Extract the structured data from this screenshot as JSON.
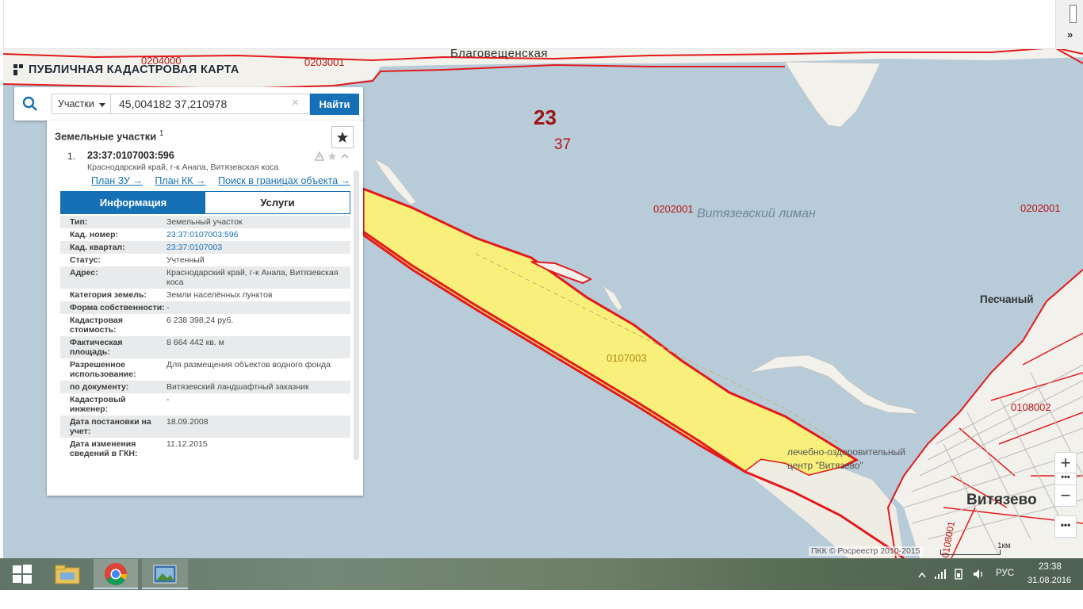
{
  "app": {
    "title": "ПУБЛИЧНАЯ КАДАСТРОВАЯ КАРТА"
  },
  "search": {
    "type_label": "Участки",
    "query": "45,004182 37,210978",
    "clear_icon": "×",
    "button_label": "Найти"
  },
  "browser": {
    "more_label": "»"
  },
  "panel": {
    "title": "Земельные участки",
    "count": "1",
    "item": {
      "index": "1.",
      "cad_number": "23:37:0107003:596",
      "address": "Краснодарский край, г-к Анапа, Витязевская коса"
    },
    "links": [
      "План ЗУ →",
      "План КК →",
      "Поиск в границах объекта →"
    ],
    "tabs": [
      "Информация",
      "Услуги"
    ],
    "rows": [
      {
        "key": "Тип:",
        "value": "Земельный участок"
      },
      {
        "key": "Кад. номер:",
        "value": "23:37:0107003:596"
      },
      {
        "key": "Кад. квартал:",
        "value": "23:37:0107003"
      },
      {
        "key": "Статус:",
        "value": "Учтенный"
      },
      {
        "key": "Адрес:",
        "value": "Краснодарский край, г-к Анапа, Витязевская коса"
      },
      {
        "key": "Категория земель:",
        "value": "Земли населённых пунктов"
      },
      {
        "key": "Форма собственности:",
        "value": "-"
      },
      {
        "key": "Кадастровая стоимость:",
        "value": "6 238 398,24 руб."
      },
      {
        "key": "Фактическая площадь:",
        "value": "8 664 442 кв. м"
      },
      {
        "key": "Разрешенное использование:",
        "value": "Для размещения объектов водного фонда"
      },
      {
        "key": "по документу:",
        "value": "Витязевский ландшафтный заказник"
      },
      {
        "key": "Кадастровый инженер:",
        "value": "-"
      },
      {
        "key": "Дата постановки на учет:",
        "value": "18.09.2008"
      },
      {
        "key": "Дата изменения сведений в ГКН:",
        "value": "11.12.2015"
      }
    ]
  },
  "map": {
    "labels": {
      "district_code": "23",
      "region_code": "37",
      "q_0204000": "0204000",
      "q_0203001": "0203001",
      "q_0202001_a": "0202001",
      "q_0202001_b": "0202001",
      "q_0107003": "0107003",
      "q_0108002": "0108002",
      "q_0108001": "0108001",
      "blagoveshchenskaya": "Благовещенская",
      "liman": "Витязевский лиман",
      "peschany": "Песчаный",
      "center_1": "лечебно-оздоровительный",
      "center_2": "центр \"Витязево\"",
      "vityazevo": "Витязево"
    },
    "copyright": "ПКК © Росреестр 2010-2015",
    "scale_label": "1км",
    "colors": {
      "water": "#b7cbd9",
      "land": "#f5f2ec",
      "parcel_fill": "#f8f07a",
      "boundary": "#e31a1c",
      "accent": "#1570b6"
    }
  },
  "controls": {
    "zoom_in": "+",
    "zoom_out": "−",
    "dots": "•••",
    "more": "•••"
  },
  "taskbar": {
    "lang": "РУС",
    "time": "23:38",
    "date": "31.08.2016"
  }
}
